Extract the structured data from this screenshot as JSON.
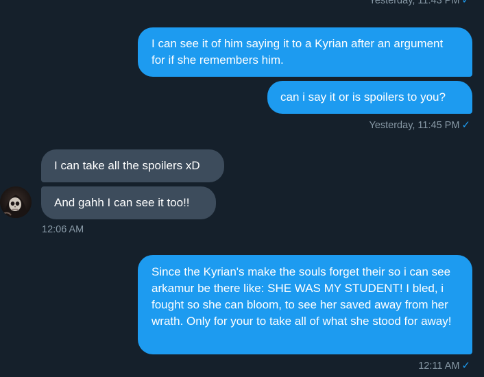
{
  "top_timestamp": {
    "time": "Yesterday, 11:43 PM",
    "check": "✓"
  },
  "messages": [
    {
      "direction": "outgoing",
      "text": "I can see it of him saying it to a Kyrian after an argument for if she remembers him."
    },
    {
      "direction": "outgoing",
      "text": "can i say it or is spoilers to you?"
    },
    {
      "direction": "incoming",
      "text": "I can take all the spoilers xD"
    },
    {
      "direction": "incoming",
      "text": "And gahh I can see it too!!"
    },
    {
      "direction": "outgoing",
      "text": "Since the Kyrian's make the souls forget their so i can see arkamur be there like: SHE WAS MY STUDENT! I bled, i fought so she can bloom, to see her saved away from her wrath. Only for your to take all of what she stood for away!"
    }
  ],
  "timestamps": {
    "group1": {
      "time": "Yesterday, 11:45 PM",
      "check": "✓"
    },
    "group2": {
      "time": "12:06 AM"
    },
    "group3": {
      "time": "12:11 AM",
      "check": "✓"
    }
  },
  "avatar": {
    "icon": "skull-avatar-icon"
  },
  "colors": {
    "background": "#15202b",
    "outgoing_bubble": "#1d9bf0",
    "incoming_bubble": "#3d4c5c",
    "meta_text": "#8899a6",
    "check": "#1d9bf0"
  }
}
